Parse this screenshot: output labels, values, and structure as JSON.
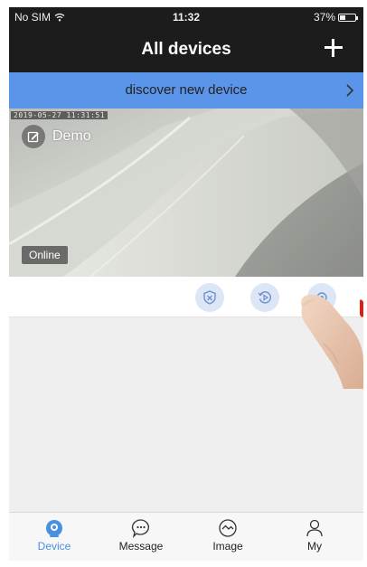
{
  "status_bar": {
    "carrier": "No SIM",
    "time": "11:32",
    "battery": "37%"
  },
  "nav": {
    "title": "All devices",
    "add_icon": "plus-icon"
  },
  "discover_banner": {
    "label": "discover new device",
    "icon": "chevron-right-icon"
  },
  "device_card": {
    "timestamp": "2019-05-27  11:31:51",
    "name": "Demo",
    "status": "Online",
    "actions": [
      {
        "icon": "shield-icon"
      },
      {
        "icon": "playback-icon"
      },
      {
        "icon": "settings-icon"
      }
    ]
  },
  "tab_bar": {
    "tabs": [
      {
        "label": "Device",
        "icon": "camera-icon",
        "active": true
      },
      {
        "label": "Message",
        "icon": "message-icon",
        "active": false
      },
      {
        "label": "Image",
        "icon": "image-icon",
        "active": false
      },
      {
        "label": "My",
        "icon": "user-icon",
        "active": false
      }
    ]
  },
  "colors": {
    "accent": "#4a90e2",
    "banner": "#5b95e9",
    "header": "#1c1c1c"
  }
}
